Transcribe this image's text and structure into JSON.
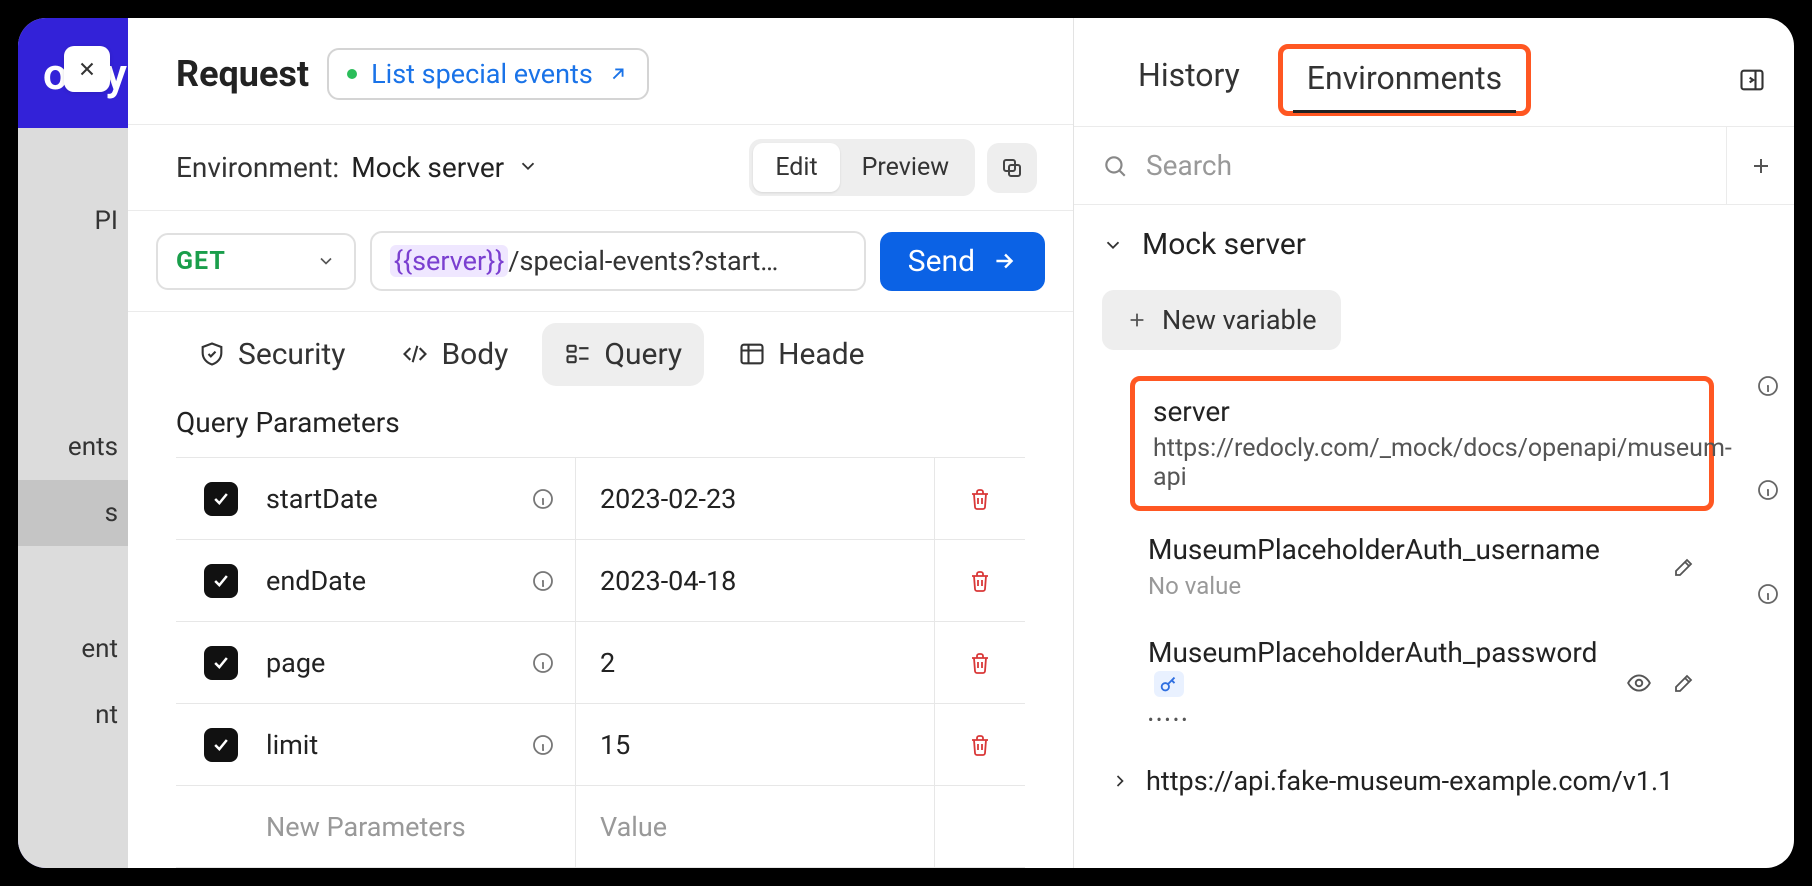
{
  "brand_partial": "ocly",
  "left_strip": {
    "items": [
      "PI",
      "ents",
      "s",
      "ent",
      "nt"
    ]
  },
  "header": {
    "title": "Request",
    "chip_label": "List special events"
  },
  "environment_bar": {
    "label": "Environment:",
    "value": "Mock server",
    "edit": "Edit",
    "preview": "Preview"
  },
  "request_line": {
    "method": "GET",
    "url_var": "{{server}}",
    "url_rest": "/special-events?start…",
    "send": "Send"
  },
  "tabs": {
    "security": "Security",
    "body": "Body",
    "query": "Query",
    "headers": "Heade"
  },
  "query": {
    "title": "Query Parameters",
    "rows": [
      {
        "name": "startDate",
        "value": "2023-02-23",
        "checked": true
      },
      {
        "name": "endDate",
        "value": "2023-04-18",
        "checked": true
      },
      {
        "name": "page",
        "value": "2",
        "checked": true
      },
      {
        "name": "limit",
        "value": "15",
        "checked": true
      }
    ],
    "new_name_placeholder": "New Parameters",
    "new_value_placeholder": "Value"
  },
  "right": {
    "tabs": {
      "history": "History",
      "environments": "Environments"
    },
    "search_placeholder": "Search",
    "env_name": "Mock server",
    "new_variable": "New variable",
    "vars": [
      {
        "name": "server",
        "value": "https://redocly.com/_mock/docs/openapi/museum-api",
        "highlight": true
      },
      {
        "name": "MuseumPlaceholderAuth_username",
        "no_value": "No value"
      },
      {
        "name": "MuseumPlaceholderAuth_password",
        "masked": "•••••",
        "is_secret": true
      }
    ],
    "collapsed_env": "https://api.fake-museum-example.com/v1.1"
  }
}
